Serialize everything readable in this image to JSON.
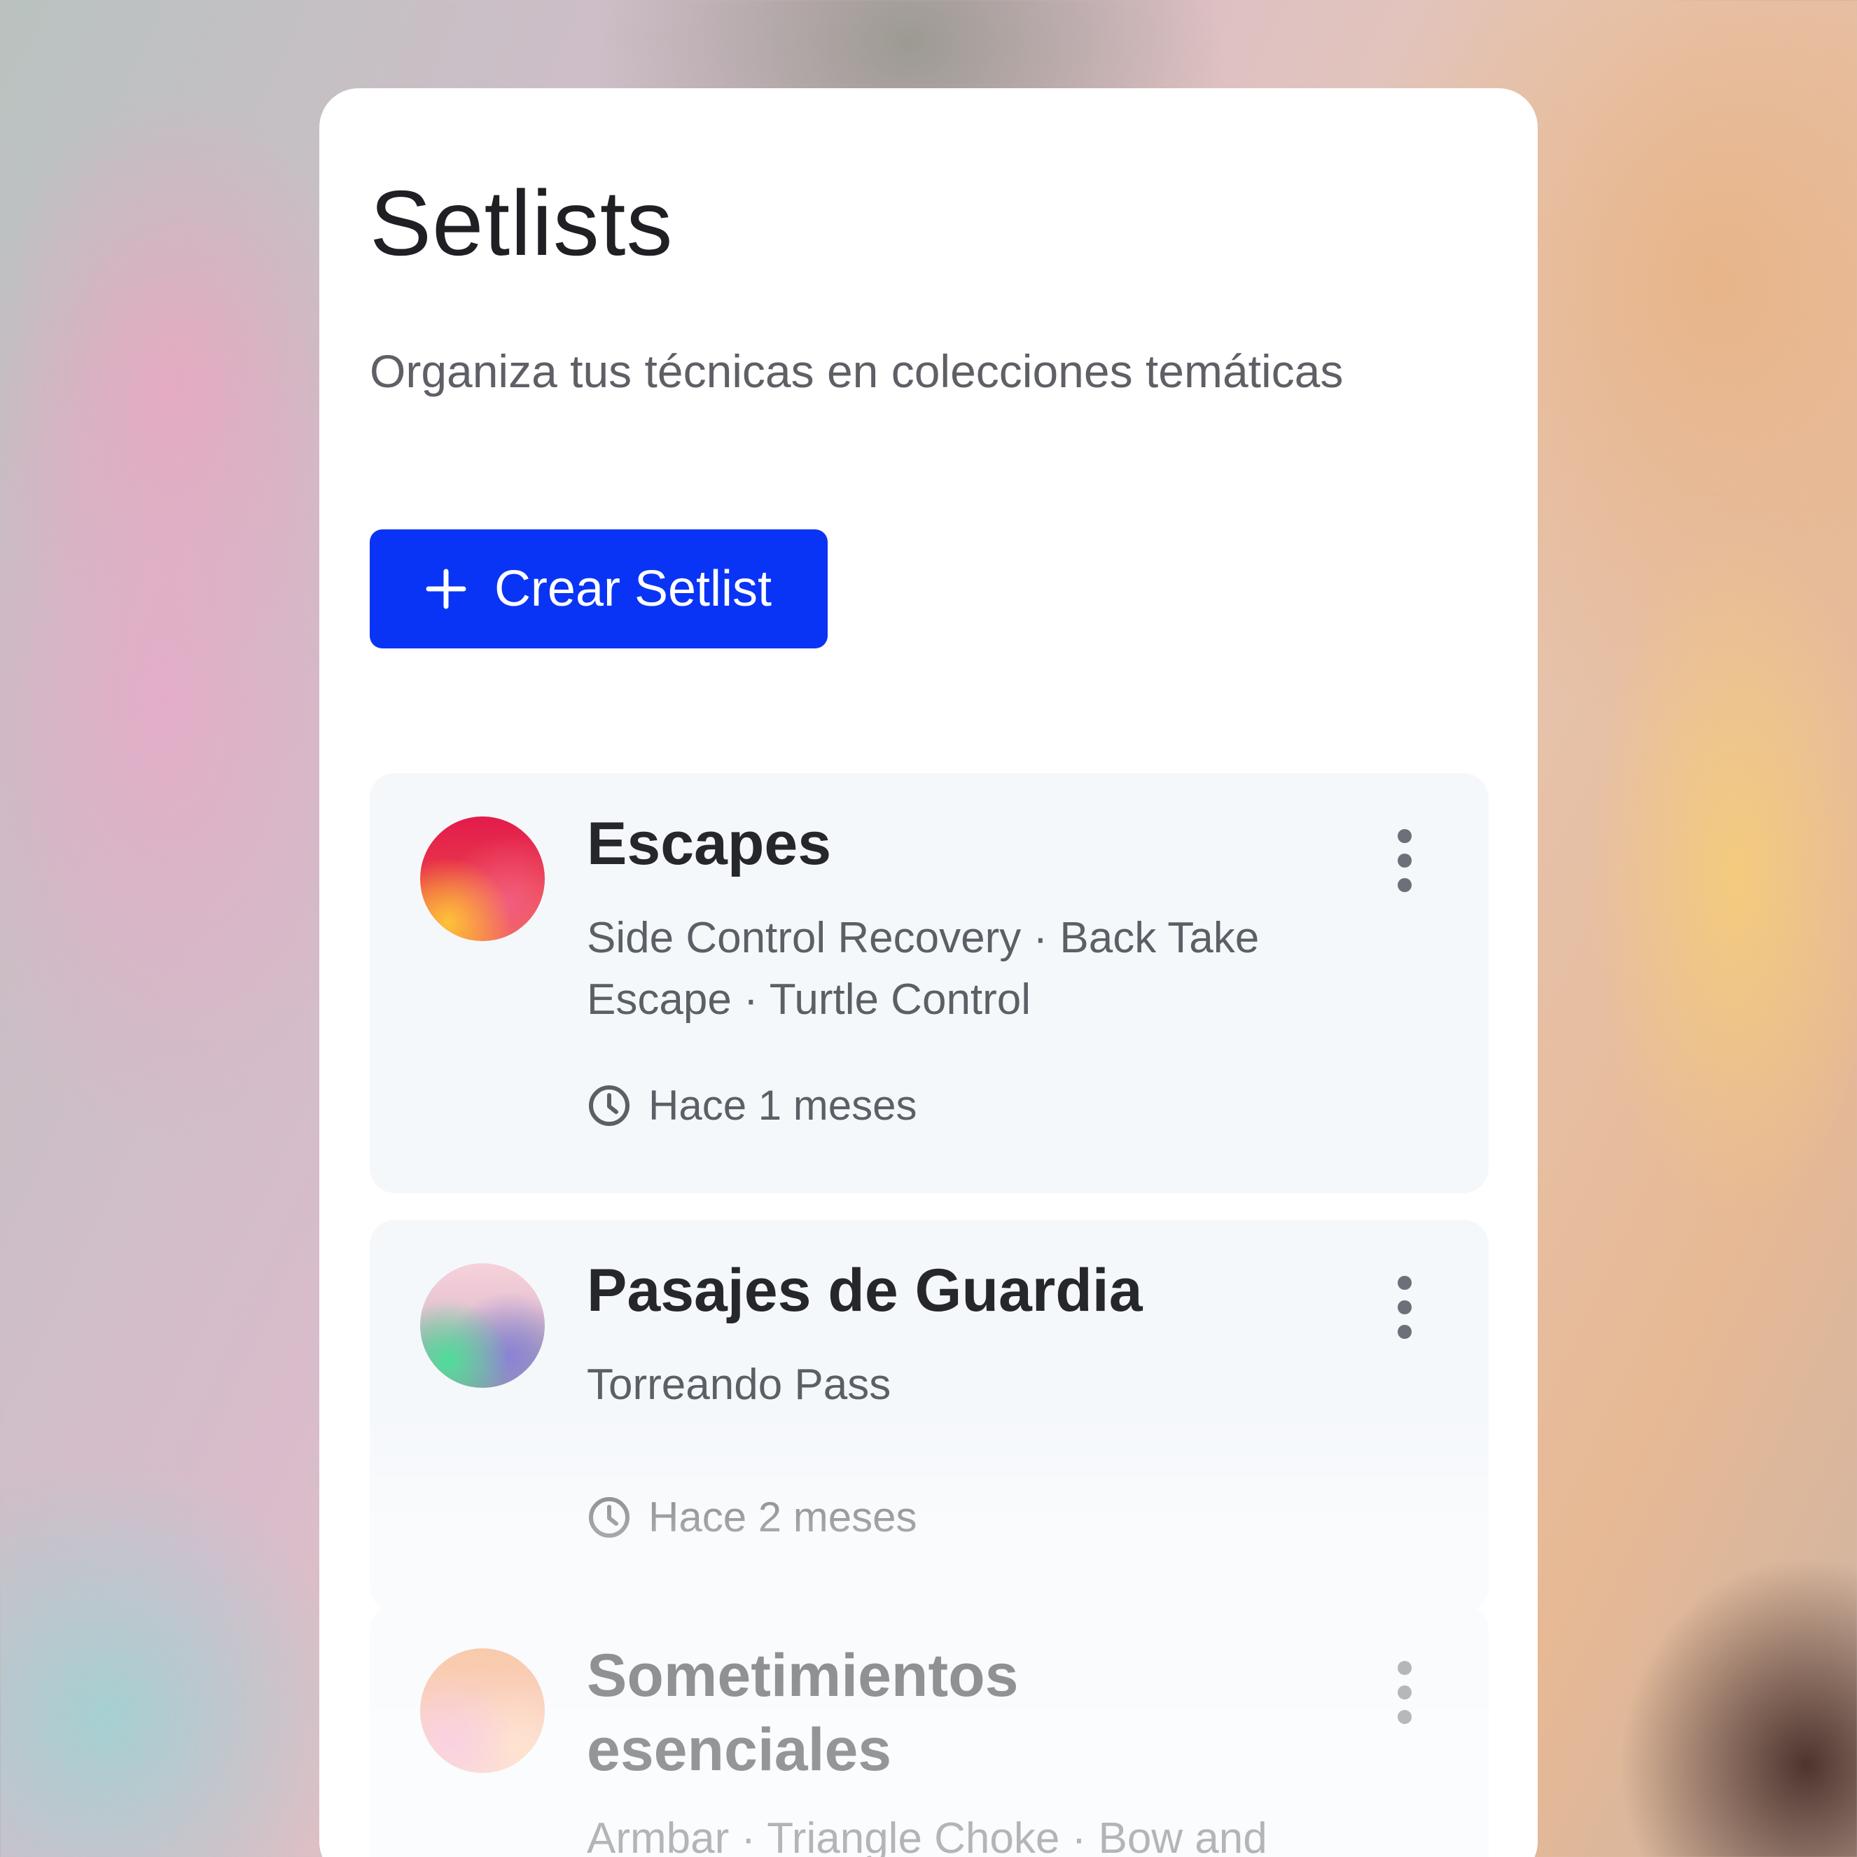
{
  "header": {
    "title": "Setlists",
    "subtitle": "Organiza tus técnicas en colecciones temáticas"
  },
  "actions": {
    "create_label": "Crear Setlist",
    "create_icon": "plus-icon"
  },
  "colors": {
    "primary": "#0a34f5",
    "card_background": "#ffffff",
    "item_background": "#f5f8fb",
    "title_text": "#26272b",
    "muted_text": "#5c5f66"
  },
  "setlists": [
    {
      "name": "Escapes",
      "techniques": "Side Control Recovery · Back Take Escape · Turtle Control",
      "updated": "Hace 1 meses",
      "menu_icon": "more-vertical-icon",
      "time_icon": "clock-icon"
    },
    {
      "name": "Pasajes de Guardia",
      "techniques": "Torreando Pass",
      "updated": "Hace 2 meses",
      "menu_icon": "more-vertical-icon",
      "time_icon": "clock-icon"
    },
    {
      "name": "Sometimientos esenciales",
      "techniques": "Armbar · Triangle Choke · Bow and",
      "menu_icon": "more-vertical-icon"
    }
  ]
}
